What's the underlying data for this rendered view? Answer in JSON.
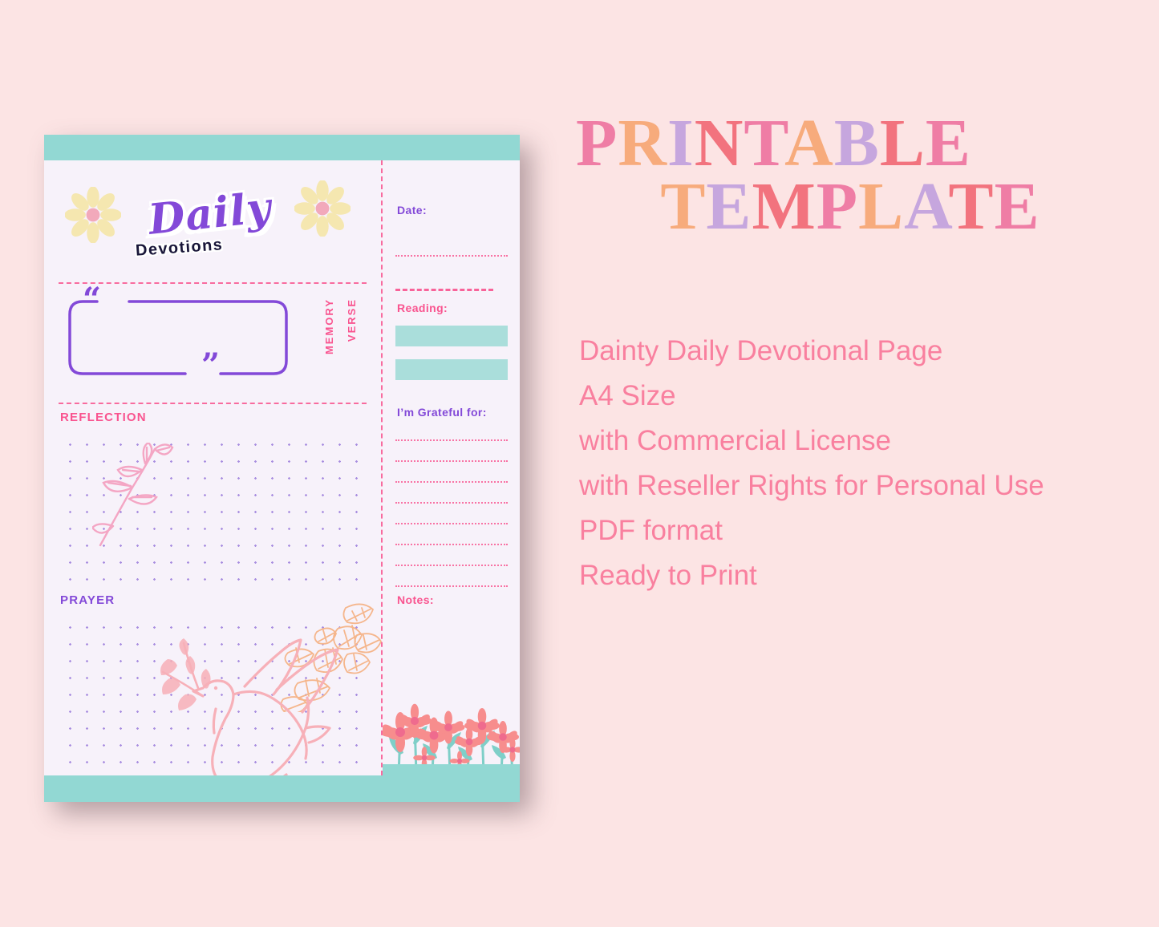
{
  "background_color": "#fce4e4",
  "promo": {
    "headline_line1": [
      {
        "char": "P",
        "color": "#ef7da5"
      },
      {
        "char": "R",
        "color": "#f7ab7c"
      },
      {
        "char": "I",
        "color": "#c6a6de"
      },
      {
        "char": "N",
        "color": "#f2737e"
      },
      {
        "char": "T",
        "color": "#ef7da5"
      },
      {
        "char": "A",
        "color": "#f7ab7c"
      },
      {
        "char": "B",
        "color": "#c6a6de"
      },
      {
        "char": "L",
        "color": "#f2737e"
      },
      {
        "char": "E",
        "color": "#ef7da5"
      }
    ],
    "headline_line2": [
      {
        "char": "T",
        "color": "#f7ab7c"
      },
      {
        "char": "E",
        "color": "#c6a6de"
      },
      {
        "char": "M",
        "color": "#f2737e"
      },
      {
        "char": "P",
        "color": "#ef7da5"
      },
      {
        "char": "L",
        "color": "#f7ab7c"
      },
      {
        "char": "A",
        "color": "#c6a6de"
      },
      {
        "char": "T",
        "color": "#f2737e"
      },
      {
        "char": "E",
        "color": "#ef7da5"
      }
    ],
    "headline_text_line1": "PRINTABLE",
    "headline_text_line2": "TEMPLATE",
    "features": [
      "Dainty Daily Devotional Page",
      "A4 Size",
      "with Commercial License",
      "with Reseller Rights for Personal Use",
      "PDF format",
      "Ready to Print"
    ],
    "features_color": "#f9809f"
  },
  "printable": {
    "page_background": "#f7f2fa",
    "band_color": "#92d8d3",
    "accent_pink": "#f9548f",
    "accent_purple": "#8349d8",
    "title": {
      "script_word": "Daily",
      "block_word": "Devotions",
      "script_color": "#8349d8",
      "block_color": "#181538"
    },
    "left_column": {
      "memory_verse_label_line1": "MEMORY",
      "memory_verse_label_line2": "VERSE",
      "quote_open": "“",
      "quote_close": "”",
      "reflection_label": "REFLECTION",
      "prayer_label": "PRAYER",
      "decorations": [
        "branch-leaves-illustration",
        "scattered-leaves-illustration",
        "dove-with-olive-branch-illustration",
        "daisy-flower-left",
        "daisy-flower-right"
      ]
    },
    "right_column": {
      "date_label": "Date:",
      "reading_label": "Reading:",
      "grateful_label": "I’m Grateful for:",
      "notes_label": "Notes:",
      "reading_bars": 2,
      "grateful_lines": 8,
      "flower_strip": "pink-daisy-border-illustration"
    }
  }
}
